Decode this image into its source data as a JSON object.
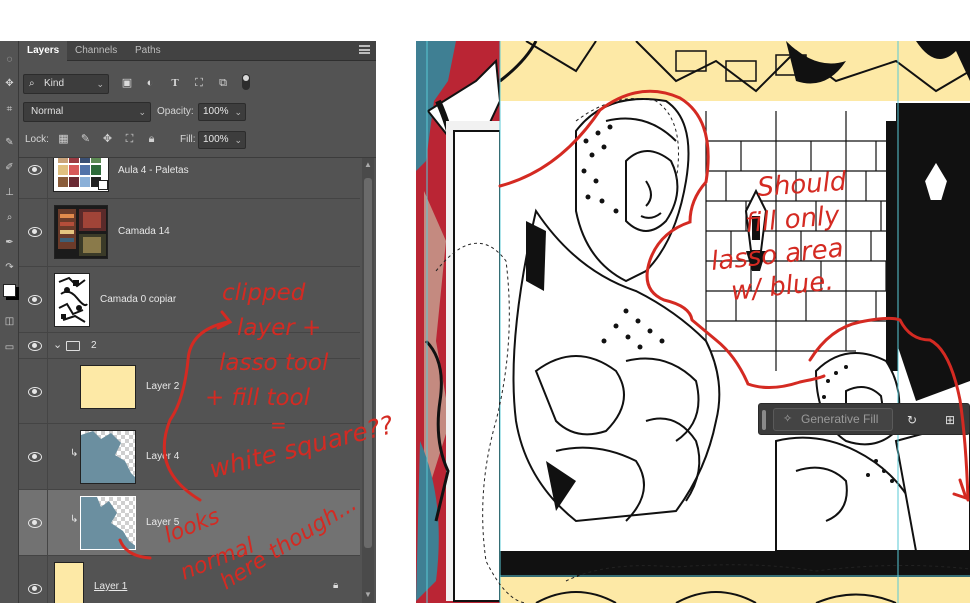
{
  "tabs": [
    "Layers",
    "Channels",
    "Paths"
  ],
  "filter": {
    "kind_label": "Kind"
  },
  "blend": {
    "mode": "Normal",
    "opacity_label": "Opacity:",
    "opacity_value": "100%"
  },
  "lock": {
    "label": "Lock:",
    "fill_label": "Fill:",
    "fill_value": "100%"
  },
  "layers": [
    {
      "name": "Aula 4 - Paletas"
    },
    {
      "name": "Camada 14"
    },
    {
      "name": "Camada 0 copiar"
    },
    {
      "name": "2"
    },
    {
      "name": "Layer 2"
    },
    {
      "name": "Layer 4"
    },
    {
      "name": "Layer 5"
    },
    {
      "name": "Layer 1"
    }
  ],
  "generative_fill": {
    "label": "Generative Fill"
  },
  "annotations": {
    "left_note": [
      "clipped",
      "layer +",
      "lasso tool",
      "+ fill tool",
      "=",
      "white square??"
    ],
    "bottom_note": [
      "looks",
      "normal",
      "here though..."
    ],
    "right_note": [
      "Should",
      "fill only",
      "lasso area",
      "w/ blue."
    ]
  },
  "colors": {
    "panel_bg": "#535353",
    "selected_row": "#727272",
    "annotation_red": "#d42a22",
    "parchment": "#fde9a6",
    "layer_blue": "#6b8fa0"
  }
}
